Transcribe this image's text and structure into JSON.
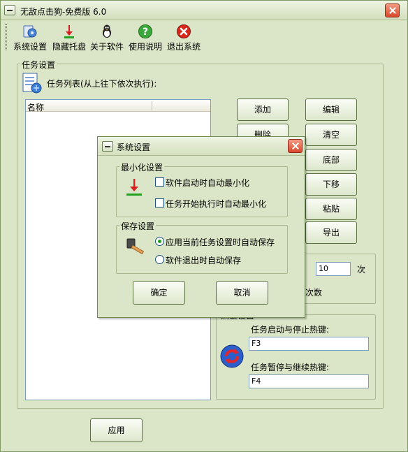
{
  "window": {
    "title": "无敌点击狗-免费版 6.0"
  },
  "toolbar": {
    "items": [
      {
        "label": "系统设置",
        "icon": "settings-icon"
      },
      {
        "label": "隐藏托盘",
        "icon": "tray-down-arrow-icon"
      },
      {
        "label": "关于软件",
        "icon": "penguin-icon"
      },
      {
        "label": "使用说明",
        "icon": "help-icon"
      },
      {
        "label": "退出系统",
        "icon": "exit-icon"
      }
    ]
  },
  "task_settings": {
    "group_title": "任务设置",
    "list_title": "任务列表(从上往下依次执行):",
    "column_name": "名称",
    "buttons": {
      "add": "添加",
      "edit": "编辑",
      "delete": "删除",
      "clear": "清空",
      "bottom": "底部",
      "move_down": "下移",
      "paste": "粘贴",
      "export": "导出"
    },
    "repeat_value": "10",
    "repeat_unit": "次",
    "repeat_suffix": "次数",
    "hotkey_group_title": "热键设置",
    "hotkey_start_stop_label": "任务启动与停止热键:",
    "hotkey_start_stop_value": "F3",
    "hotkey_pause_resume_label": "任务暂停与继续热键:",
    "hotkey_pause_resume_value": "F4",
    "apply": "应用"
  },
  "dialog": {
    "title": "系统设置",
    "minimize_group": "最小化设置",
    "minimize_on_start": "软件启动时自动最小化",
    "minimize_on_task": "任务开始执行时自动最小化",
    "save_group": "保存设置",
    "save_on_apply": "应用当前任务设置时自动保存",
    "save_on_exit": "软件退出时自动保存",
    "save_selected": "save_on_apply",
    "ok": "确定",
    "cancel": "取消"
  },
  "colors": {
    "accent_green": "#21a121",
    "close_red": "#d9492c",
    "window_bg": "#dbe6c8"
  }
}
